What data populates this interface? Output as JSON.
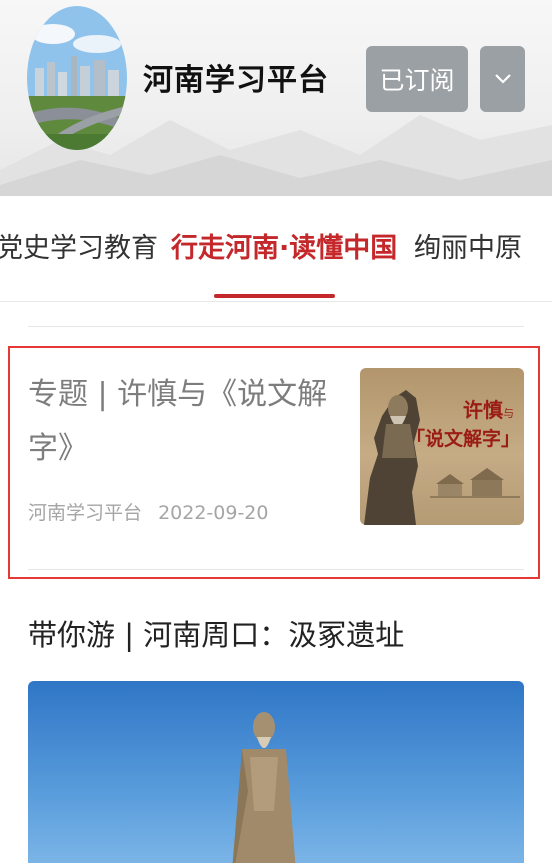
{
  "header": {
    "account_name": "河南学习平台",
    "subscribe_label": "已订阅",
    "more_icon": "chevron-down-icon"
  },
  "tabs": [
    {
      "label": "党史学习教育",
      "active": false
    },
    {
      "label": "行走河南·读懂中国",
      "active": true
    },
    {
      "label": "绚丽中原",
      "active": false
    }
  ],
  "articles": [
    {
      "title": "专题 | 许慎与《说文解字》",
      "source": "河南学习平台",
      "date": "2022-09-20",
      "thumbnail_text": {
        "line1": "许慎",
        "line1_small": "与",
        "line2": "「说文解字」"
      }
    },
    {
      "title": "带你游 | 河南周口：汲冢遗址"
    }
  ],
  "colors": {
    "accent": "#c4282b",
    "highlight_border": "#e53935",
    "subscribe_bg": "#9aa0a3"
  }
}
